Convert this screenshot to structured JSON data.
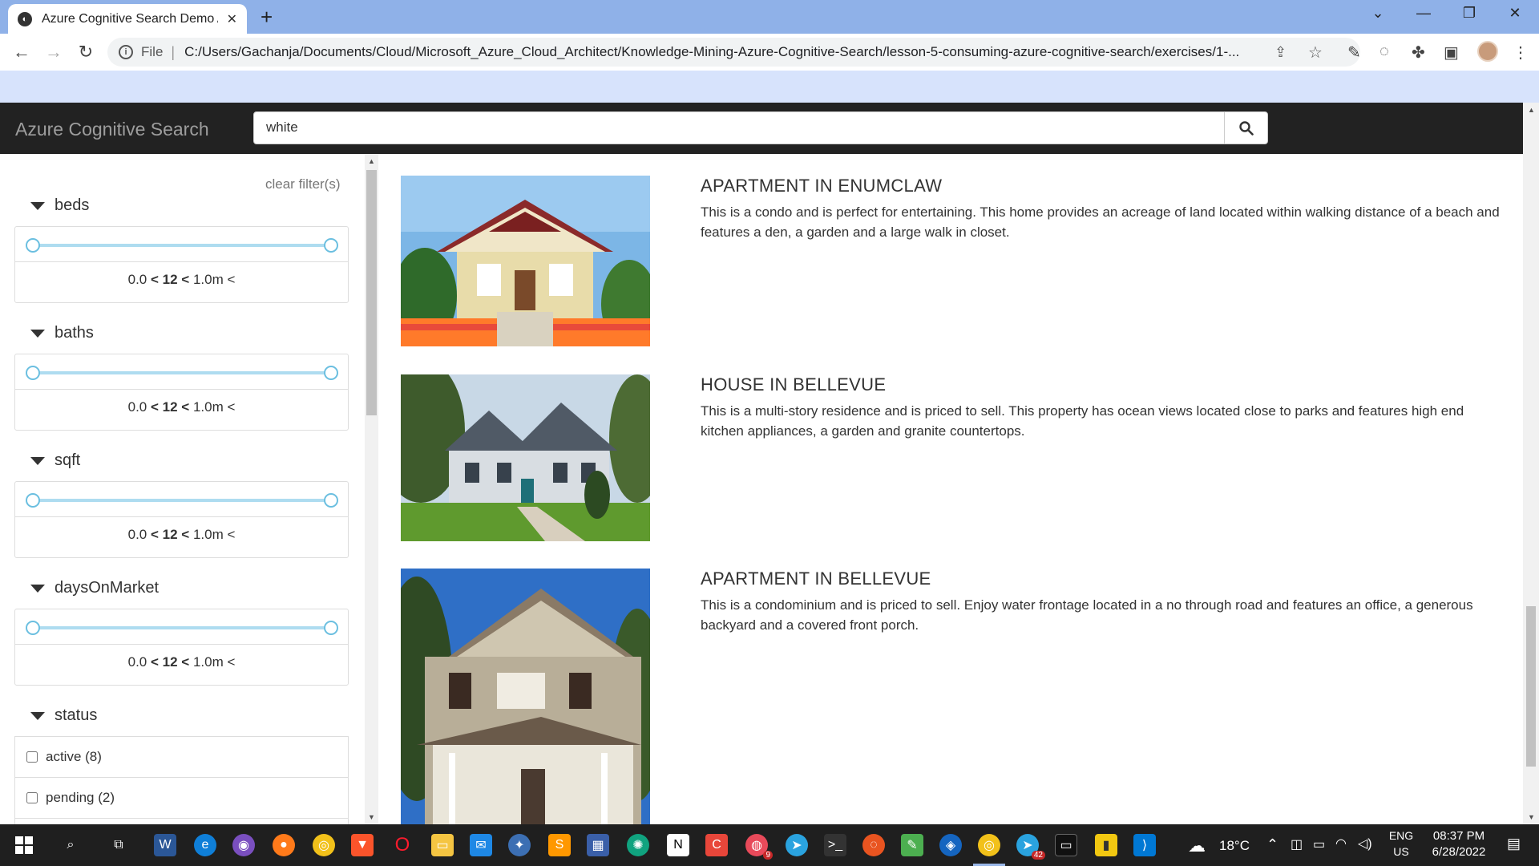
{
  "browser": {
    "tab_title": "Azure Cognitive Search Demo App",
    "tab_close": "✕",
    "new_tab": "+",
    "scheme": "File",
    "url": "C:/Users/Gachanja/Documents/Cloud/Microsoft_Azure_Cloud_Architect/Knowledge-Mining-Azure-Cognitive-Search/lesson-5-consuming-azure-cognitive-search/exercises/1-..."
  },
  "app": {
    "brand": "Azure Cognitive Search",
    "search_value": "white"
  },
  "sidebar": {
    "clear_filters": "clear filter(s)",
    "range_facets": [
      {
        "label": "beds",
        "min": "0.0",
        "mid": "12",
        "max": "1.0m"
      },
      {
        "label": "baths",
        "min": "0.0",
        "mid": "12",
        "max": "1.0m"
      },
      {
        "label": "sqft",
        "min": "0.0",
        "mid": "12",
        "max": "1.0m"
      },
      {
        "label": "daysOnMarket",
        "min": "0.0",
        "mid": "12",
        "max": "1.0m"
      }
    ],
    "status_facet": {
      "label": "status",
      "options": [
        {
          "label": "active (8)"
        },
        {
          "label": "pending (2)"
        }
      ]
    }
  },
  "results": [
    {
      "title": "APARTMENT IN ENUMCLAW",
      "description": "This is a condo and is perfect for entertaining. This home provides an acreage of land located within walking distance of a beach and features a den, a garden and a large walk in closet."
    },
    {
      "title": "HOUSE IN BELLEVUE",
      "description": "This is a multi-story residence and is priced to sell. This property has ocean views located close to parks and features high end kitchen appliances, a garden and granite countertops."
    },
    {
      "title": "APARTMENT IN BELLEVUE",
      "description": "This is a condominium and is priced to sell. Enjoy water frontage located in a no through road and features an office, a generous backyard and a covered front porch."
    }
  ],
  "taskbar": {
    "temperature": "18°C",
    "lang_top": "ENG",
    "lang_bottom": "US",
    "time": "08:37 PM",
    "date": "6/28/2022",
    "badge_a": "9",
    "badge_b": "42",
    "icons": [
      "windows-start-icon",
      "search-icon",
      "task-view-icon",
      "word-icon",
      "edge-icon",
      "tor-icon",
      "firefox-icon",
      "chrome-icon",
      "brave-icon",
      "opera-icon",
      "file-explorer-icon",
      "mail-icon",
      "app-icon",
      "sublime-icon",
      "calculator-icon",
      "openai-icon",
      "notion-icon",
      "app-red-icon",
      "chrome-profile-icon",
      "telegram-icon",
      "terminal-icon",
      "ubuntu-icon",
      "notepad-icon",
      "vpn-icon",
      "chrome-active-icon",
      "telegram-active-icon",
      "cmd-icon",
      "powerbi-icon",
      "vscode-icon"
    ]
  }
}
